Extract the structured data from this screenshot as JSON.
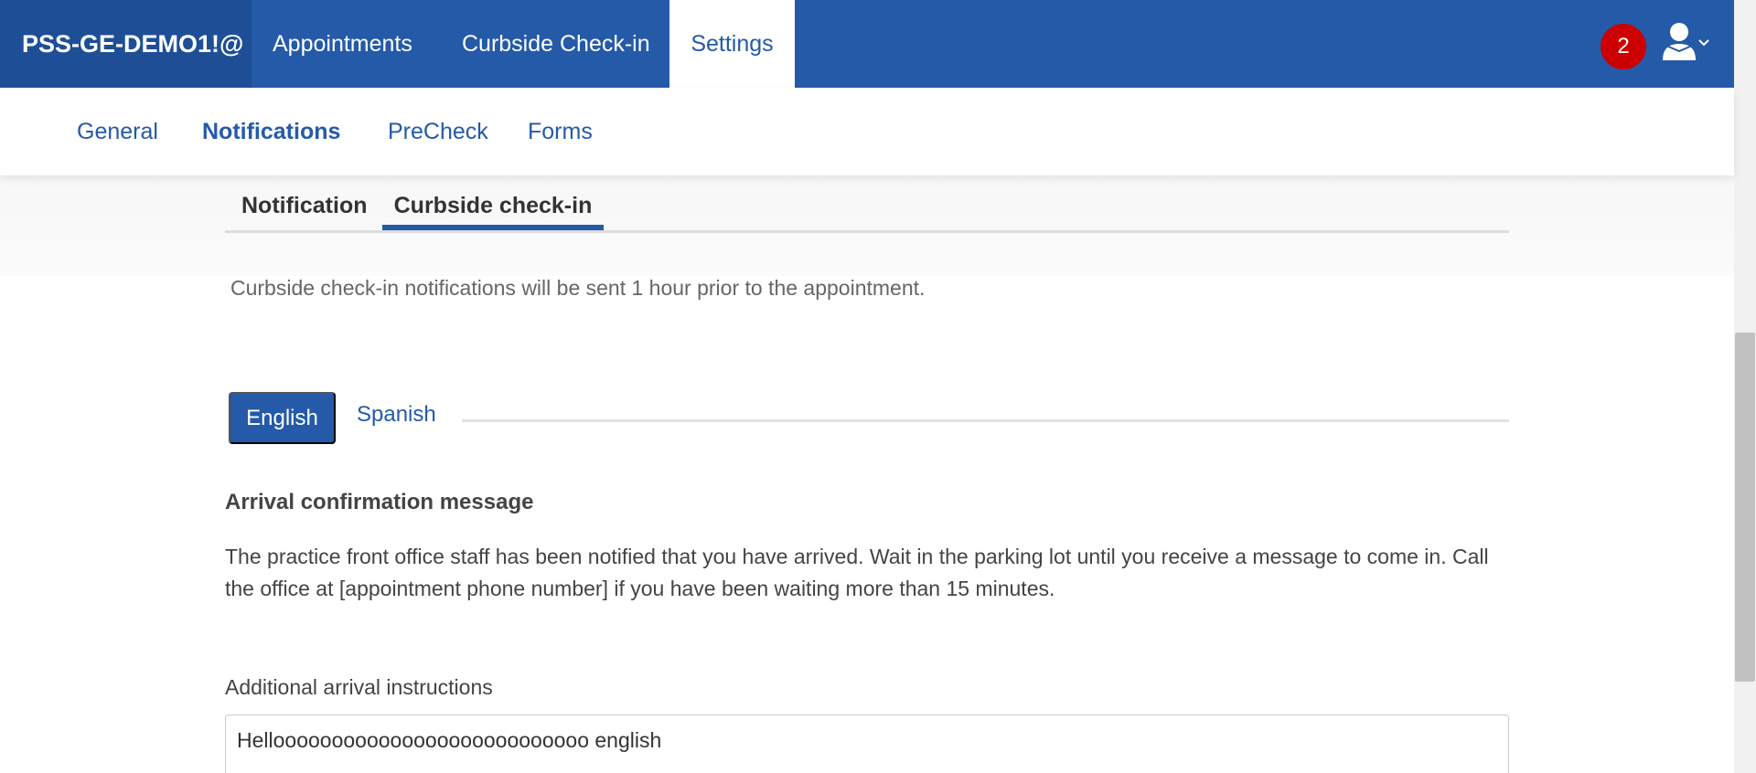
{
  "topnav": {
    "brand": "PSS-GE-DEMO1!@",
    "links": [
      "Appointments",
      "Curbside Check-in",
      "Settings"
    ],
    "active": "Settings",
    "notification_count": "2",
    "colors": {
      "nav_bg": "#245aa8",
      "brand_bg": "#1e4f96",
      "badge": "#cc0000"
    }
  },
  "subnav": {
    "items": [
      "General",
      "Notifications",
      "PreCheck",
      "Forms"
    ],
    "active": "Notifications"
  },
  "tabs": {
    "items": [
      "Notification",
      "Curbside check-in"
    ],
    "active": "Curbside check-in"
  },
  "info_text": "Curbside check-in notifications will be sent 1 hour prior to the appointment.",
  "language_tabs": {
    "items": [
      "English",
      "Spanish"
    ],
    "active": "English"
  },
  "arrival_confirmation": {
    "heading": "Arrival confirmation message",
    "message": "The practice front office staff has been notified that you have arrived. Wait in the parking lot until you receive a message to come in. Call the office at [appointment phone number] if you have been waiting more than 15 minutes."
  },
  "additional_instructions": {
    "label": "Additional arrival instructions",
    "value": "Hellooooooooooooooooooooooooooo english"
  }
}
